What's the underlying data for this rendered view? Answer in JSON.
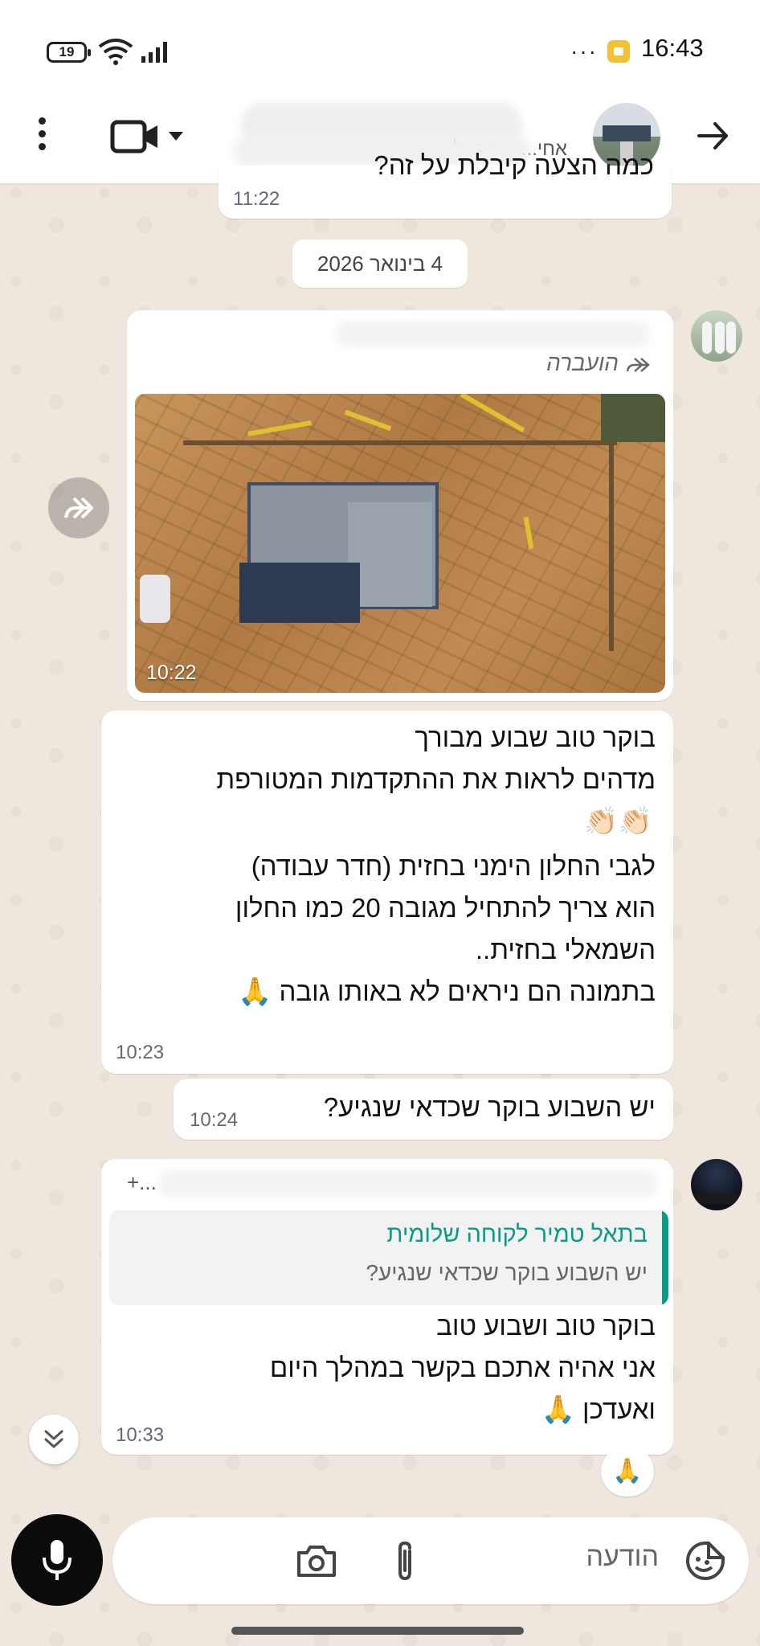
{
  "status_bar": {
    "battery": "19",
    "more": "···",
    "time": "16:43"
  },
  "header": {
    "subtitle": "אחי... ...בתאל",
    "more_icon": "vertical-dots-icon",
    "video_icon": "video-camera-icon",
    "back_icon": "arrow-right-icon"
  },
  "messages": {
    "prev_text": "כמה הצעה קיבלת על זה?",
    "prev_time": "11:22",
    "date_chip": "4 בינואר 2026",
    "forwarded_label": "הועברה",
    "image_time": "10:22",
    "msg1": {
      "lines": [
        "בוקר טוב שבוע מבורך",
        "מדהים לראות את ההתקדמות המטורפת"
      ],
      "emoji_line": "👏🏻👏🏻",
      "lines2": [
        "לגבי החלון הימני בחזית (חדר עבודה)",
        "הוא צריך להתחיל מגובה 20 כמו החלון",
        "השמאלי בחזית.."
      ],
      "last_line": "בתמונה הם ניראים לא באותו גובה",
      "last_emoji": "🙏",
      "time": "10:23"
    },
    "msg2": {
      "text": "יש השבוע בוקר שכדאי שנגיע?",
      "time": "10:24"
    },
    "msg3": {
      "sender_partial": "+...",
      "quote_name": "בתאל טמיר לקוחה שלומית",
      "quote_text": "יש השבוע בוקר שכדאי שנגיע?",
      "lines": [
        "בוקר טוב ושבוע טוב",
        "אני אהיה אתכם בקשר במהלך היום"
      ],
      "last_line": "ואעדכן",
      "last_emoji": "🙏",
      "time": "10:33"
    },
    "reaction": "🙏"
  },
  "input": {
    "placeholder": "הודעה",
    "icons": [
      "sticker-icon",
      "attach-icon",
      "camera-icon",
      "mic-icon"
    ]
  },
  "colors": {
    "accent": "#0b9a85",
    "bubble": "#ffffff",
    "wallpaper": "#efe7dd"
  }
}
